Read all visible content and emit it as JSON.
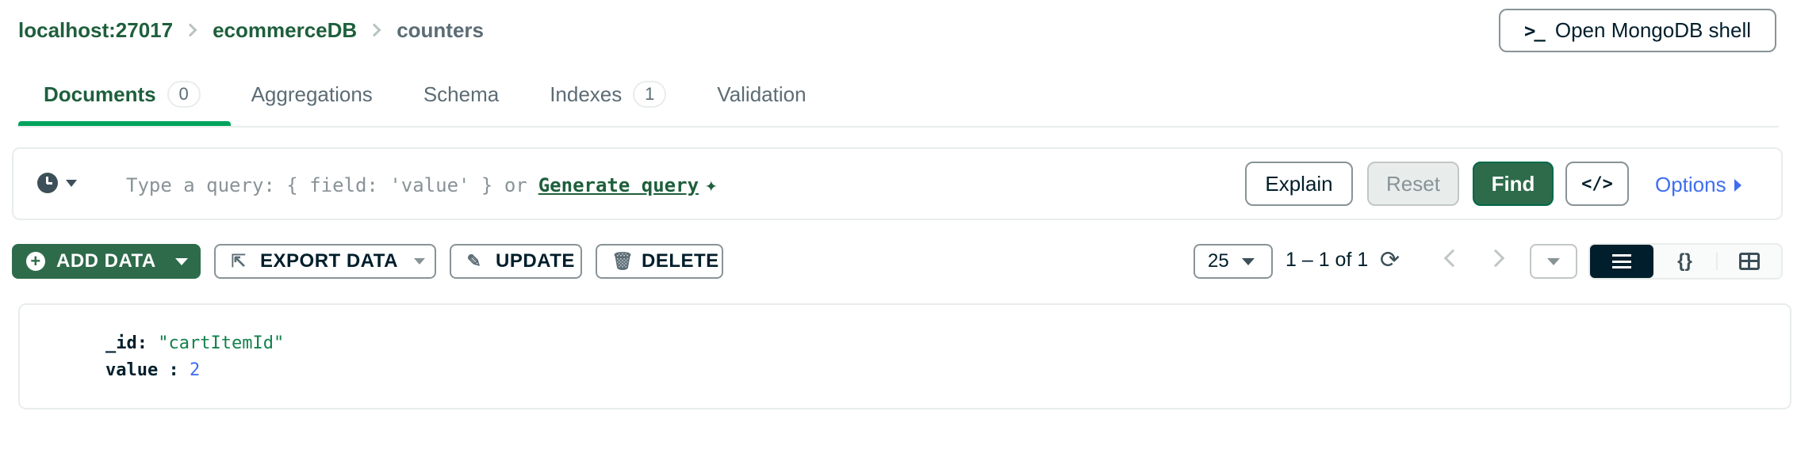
{
  "breadcrumb": {
    "host": "localhost:27017",
    "database": "ecommerceDB",
    "collection": "counters"
  },
  "header": {
    "shell_button": "Open MongoDB shell",
    "shell_prompt": ">_"
  },
  "tabs": [
    {
      "label": "Documents",
      "count": "0",
      "active": true
    },
    {
      "label": "Aggregations"
    },
    {
      "label": "Schema"
    },
    {
      "label": "Indexes",
      "count": "1"
    },
    {
      "label": "Validation"
    }
  ],
  "query": {
    "placeholder": "Type a query: { field: 'value' } or",
    "generate_link": "Generate query",
    "explain": "Explain",
    "reset": "Reset",
    "find": "Find",
    "code_toggle": "</>",
    "options": "Options"
  },
  "toolbar": {
    "add_data": "ADD DATA",
    "export_data": "EXPORT DATA",
    "update": "UPDATE",
    "delete": "DELETE",
    "page_size": "25",
    "page_info": "1 – 1 of 1"
  },
  "view_toggle": {
    "json_label": "{}"
  },
  "document": {
    "fields": [
      {
        "key": "_id",
        "value": "\"cartItemId\""
      },
      {
        "key": "value",
        "value": "2"
      }
    ]
  },
  "colors": {
    "brand_green": "#2e6b4a",
    "accent_green": "#00a35c",
    "link_blue": "#3f6ef0"
  },
  "icons": [
    "chevron-right-icon",
    "terminal-icon",
    "clock-icon",
    "sparkle-icon",
    "plus-circle-icon",
    "export-icon",
    "pencil-icon",
    "trash-icon",
    "refresh-icon",
    "list-view-icon",
    "json-view-icon",
    "table-view-icon"
  ]
}
